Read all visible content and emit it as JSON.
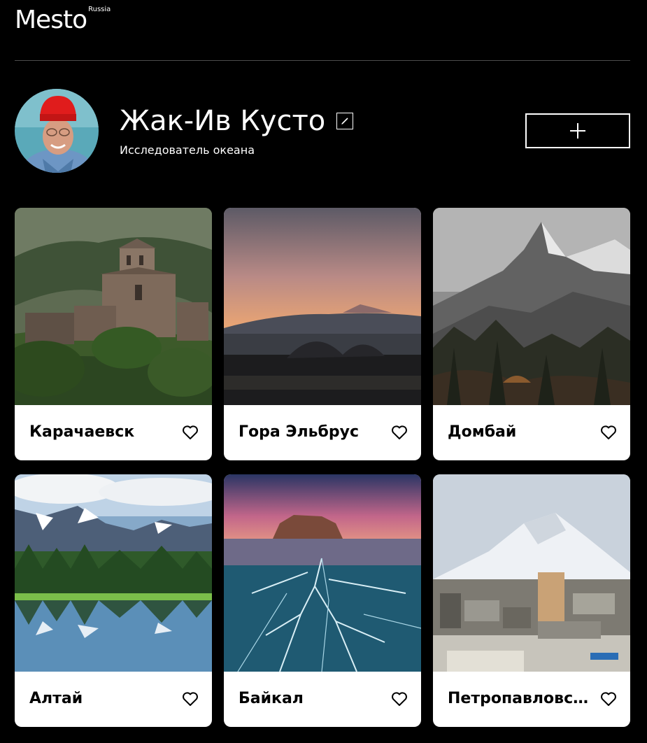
{
  "header": {
    "logo_text": "Mesto",
    "logo_sub": "Russia"
  },
  "profile": {
    "name": "Жак-Ив Кусто",
    "about": "Исследователь океана",
    "avatar_icon": "avatar-photo",
    "edit_icon": "pencil-icon",
    "add_icon": "plus-icon"
  },
  "cards": [
    {
      "title": "Карачаевск",
      "like_icon": "heart-icon"
    },
    {
      "title": "Гора Эльбрус",
      "like_icon": "heart-icon"
    },
    {
      "title": "Домбай",
      "like_icon": "heart-icon"
    },
    {
      "title": "Алтай",
      "like_icon": "heart-icon"
    },
    {
      "title": "Байкал",
      "like_icon": "heart-icon"
    },
    {
      "title": "Петропавловск-Камчатский",
      "like_icon": "heart-icon"
    }
  ],
  "colors": {
    "background": "#000000",
    "text": "#ffffff",
    "card_bg": "#ffffff",
    "card_text": "#000000",
    "divider": "#545454"
  }
}
